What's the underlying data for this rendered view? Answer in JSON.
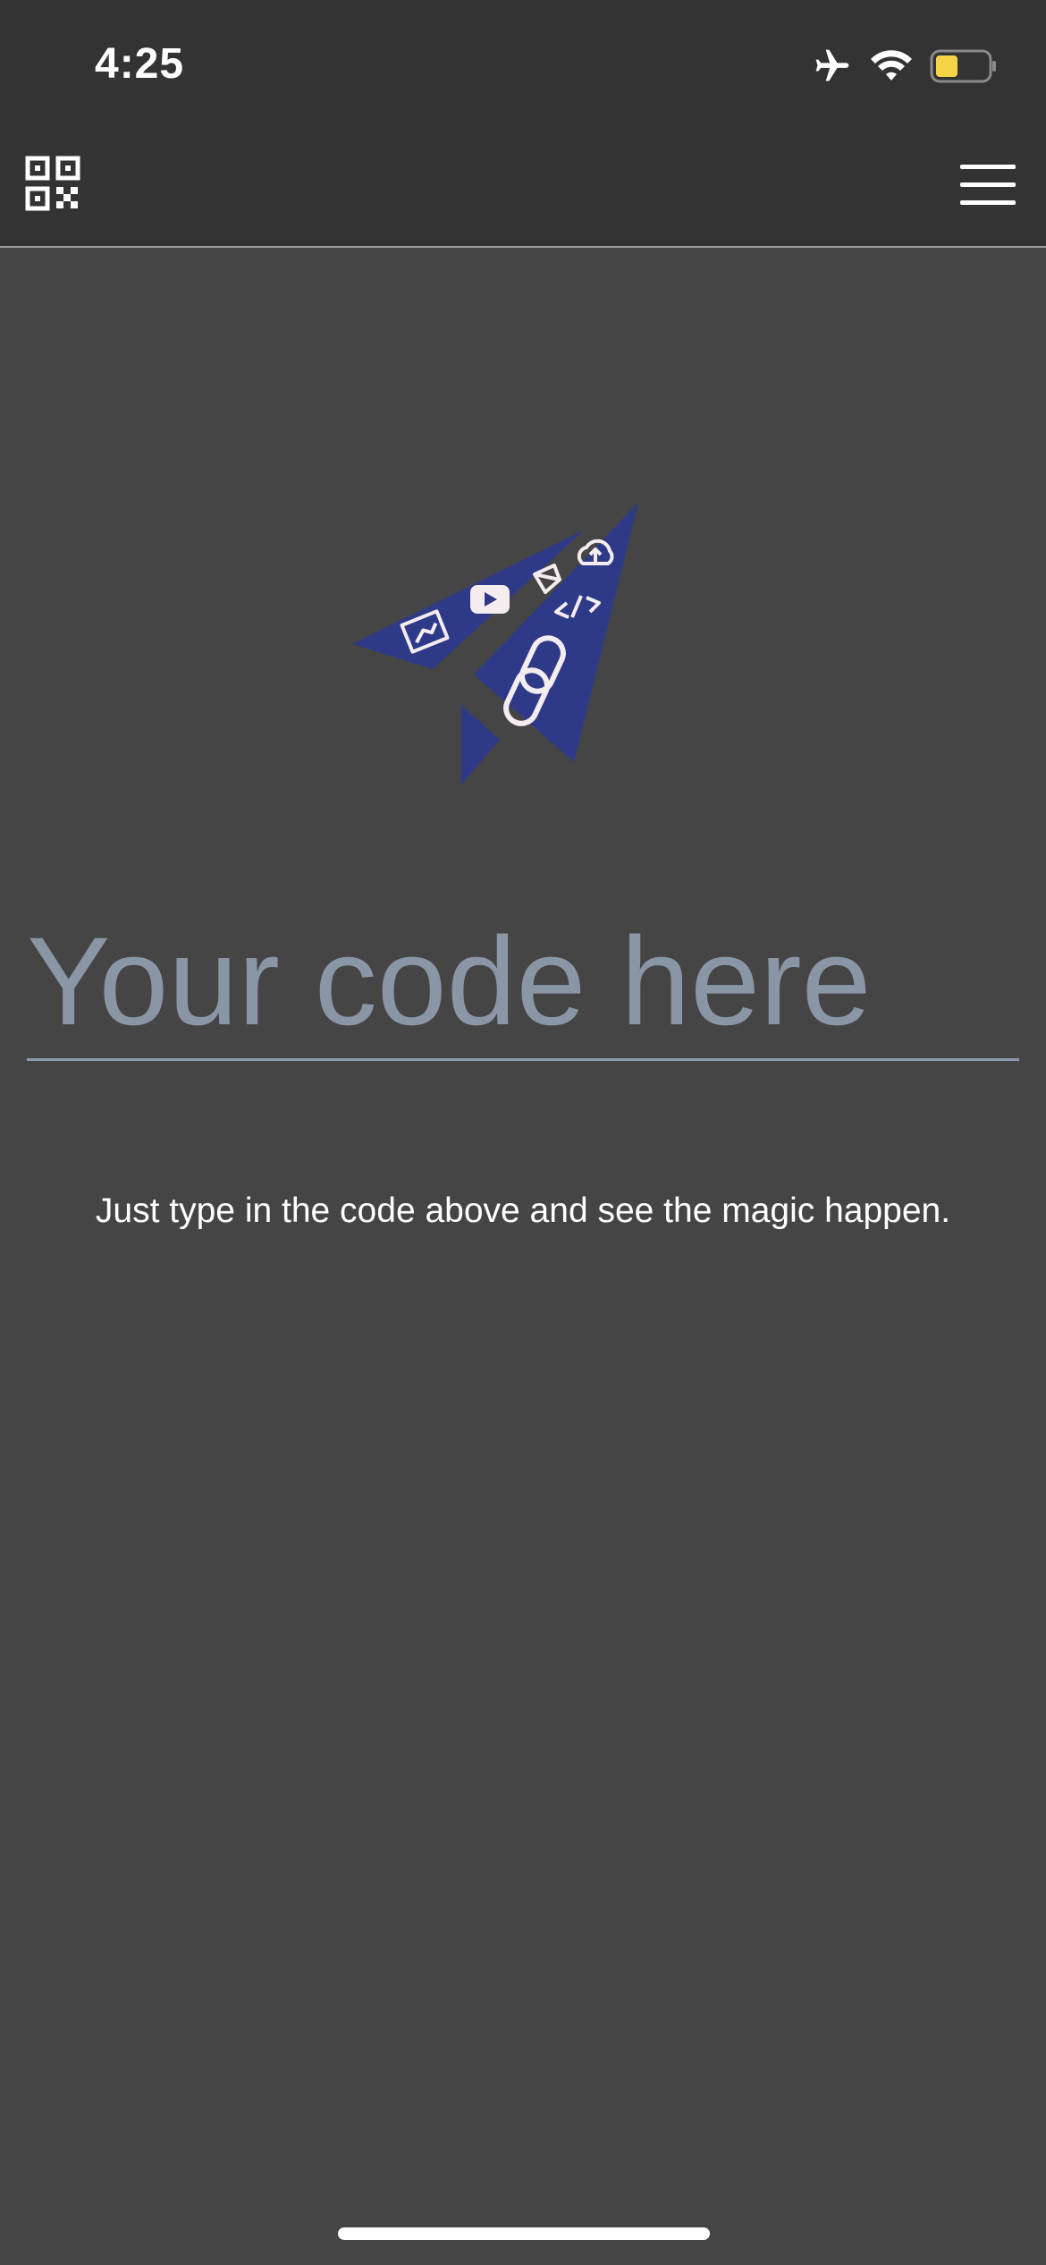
{
  "status_bar": {
    "time": "4:25",
    "icons": [
      "airplane-icon",
      "wifi-icon",
      "battery-icon"
    ],
    "battery_color": "#f5d347"
  },
  "app_bar": {
    "left_icon": "qr-code-icon",
    "right_icon": "hamburger-menu-icon"
  },
  "logo": {
    "icon": "paper-plane-logo",
    "color": "#2e3a87"
  },
  "code_input": {
    "placeholder": "Your code here",
    "value": ""
  },
  "hint_text": "Just type in the code above and see the magic happen.",
  "colors": {
    "background": "#454545",
    "header": "#333333",
    "accent": "#2e3a87"
  }
}
